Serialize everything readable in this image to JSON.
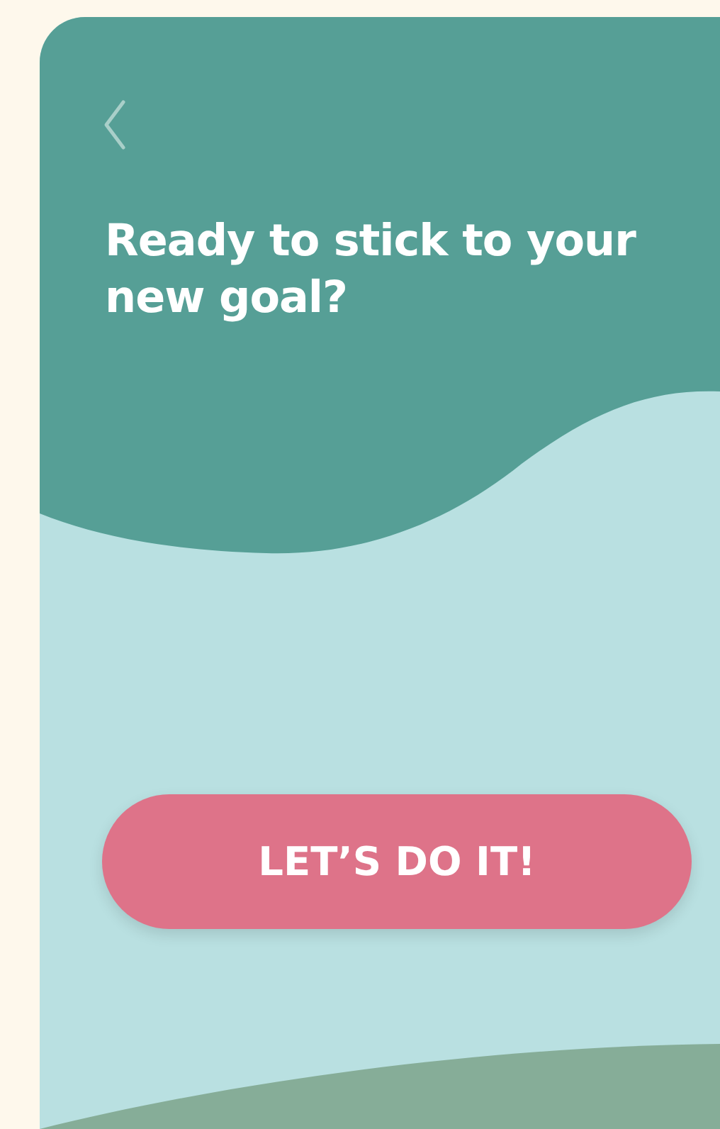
{
  "title": "Ready to stick to your new goal?",
  "button": {
    "label": "LET’S DO IT!"
  }
}
